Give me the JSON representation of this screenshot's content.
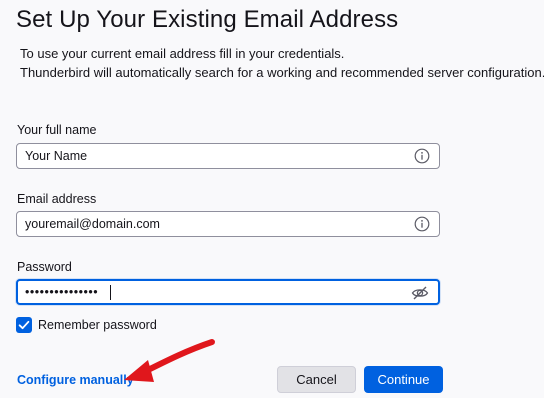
{
  "header": {
    "title": "Set Up Your Existing Email Address",
    "description_line1": "To use your current email address fill in your credentials.",
    "description_line2": "Thunderbird will automatically search for a working and recommended server configuration."
  },
  "form": {
    "full_name": {
      "label": "Your full name",
      "value": "Your Name",
      "icon": "info-icon"
    },
    "email": {
      "label": "Email address",
      "value": "youremail@domain.com",
      "icon": "info-icon"
    },
    "password": {
      "label": "Password",
      "value": "•••••••••••••••",
      "icon": "eye-slash-icon",
      "focused": true
    },
    "remember": {
      "label": "Remember password",
      "checked": true
    }
  },
  "footer": {
    "configure_manually": "Configure manually",
    "cancel": "Cancel",
    "continue": "Continue"
  },
  "colors": {
    "accent": "#0061e0",
    "annotation_arrow": "#e0171c",
    "background": "#f9f9fb"
  }
}
